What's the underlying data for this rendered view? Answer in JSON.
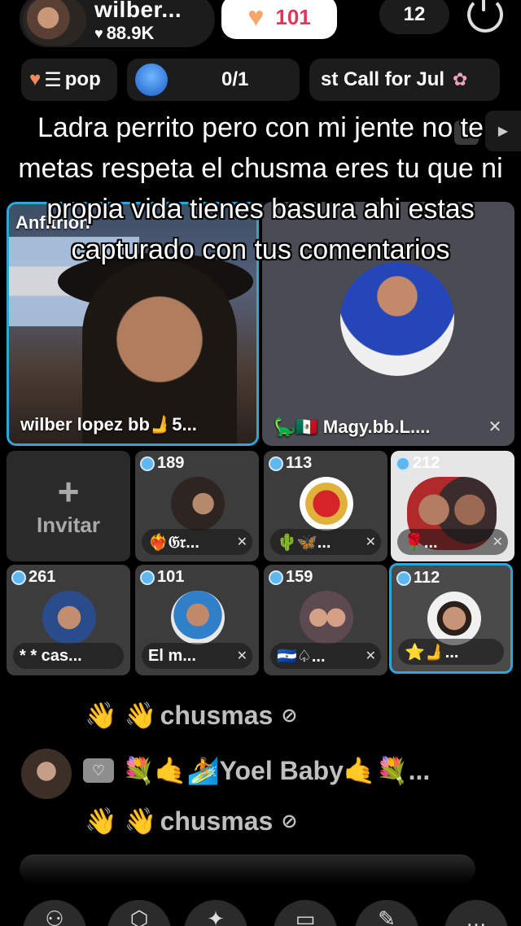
{
  "header": {
    "host_name": "wilber...",
    "host_likes": "88.9K",
    "follow_count": "101",
    "viewer_count": "12"
  },
  "info_row": {
    "popularity_label": "pop",
    "goal_progress": "0/1",
    "event_label": "st Call for Jul"
  },
  "caption": {
    "text": "Ladra perrito pero con mi jente no te metas  respeta el chusma eres tu que ni propia vida tienes basura ahi estas capturado con tus comentarios"
  },
  "main_tiles": [
    {
      "label": "Anfitrión",
      "name": "wilber lopez bb🫸5..."
    },
    {
      "name": "🦕🇲🇽 Magy.bb.L...."
    }
  ],
  "grid": {
    "invite_label": "Invitar",
    "cells": [
      {
        "badge": "189",
        "name": "❤️‍🔥𝔊𝔯..."
      },
      {
        "badge": "113",
        "name": "🌵🦋..."
      },
      {
        "badge": "212",
        "name": "🌹..."
      },
      {
        "badge": "261",
        "name": "* * cas..."
      },
      {
        "badge": "101",
        "name": "El m..."
      },
      {
        "badge": "159",
        "name": "🇸🇻♤..."
      },
      {
        "badge": "112",
        "name": "⭐🫸..."
      }
    ]
  },
  "chat": {
    "messages": [
      {
        "emojis": "👋 👋",
        "text": "chusmas"
      },
      {
        "user": "💐🤙🏄Yoel Baby🤙💐..."
      },
      {
        "emojis": "👋 👋",
        "text": "chusmas"
      }
    ]
  },
  "colors": {
    "accent_border": "#2fa6d9",
    "follow_text": "#e5345a",
    "background": "#000000"
  },
  "icons": [
    "heart-icon",
    "power-icon",
    "goal-icon",
    "gift-icon",
    "mute-icon",
    "plus-icon",
    "hide-icon"
  ]
}
